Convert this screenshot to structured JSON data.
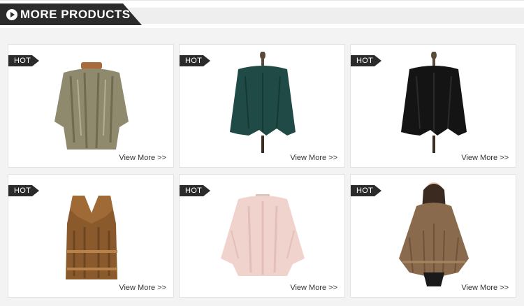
{
  "section": {
    "title": "MORE PRODUCTS"
  },
  "colors": {
    "header_dark": "#2b2b2b",
    "header_bar": "#eeeeee",
    "panel_bg": "#f3f3f3"
  },
  "products": [
    {
      "badge": "HOT",
      "link_label": "View More >>",
      "icon": "fur-coat-natural-icon",
      "fur_color": "#8f8a6e"
    },
    {
      "badge": "HOT",
      "link_label": "View More >>",
      "icon": "knitted-fur-cardigan-green-icon",
      "fur_color": "#1f4a45"
    },
    {
      "badge": "HOT",
      "link_label": "View More >>",
      "icon": "knitted-fur-cardigan-black-icon",
      "fur_color": "#141414"
    },
    {
      "badge": "HOT",
      "link_label": "View More >>",
      "icon": "fur-vest-brown-icon",
      "fur_color": "#8a5a2c"
    },
    {
      "badge": "HOT",
      "link_label": "View More >>",
      "icon": "fur-jacket-pink-icon",
      "fur_color": "#f1d3cd"
    },
    {
      "badge": "HOT",
      "link_label": "View More >>",
      "icon": "fur-poncho-brown-icon",
      "fur_color": "#8a6a4d"
    }
  ]
}
